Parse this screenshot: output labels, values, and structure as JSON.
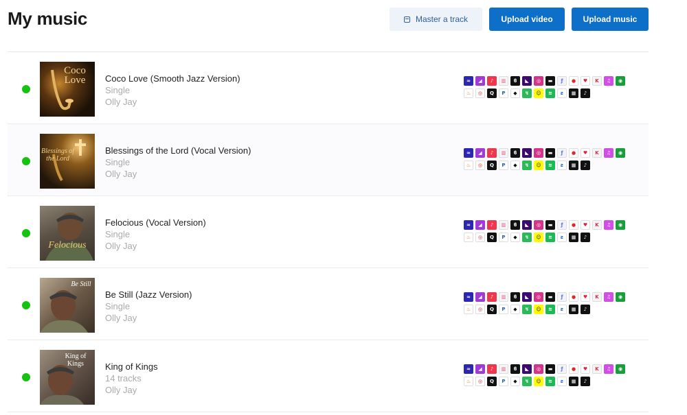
{
  "header": {
    "title": "My music",
    "master_label": "Master a track",
    "upload_video_label": "Upload video",
    "upload_music_label": "Upload music"
  },
  "colors": {
    "accent": "#0d6fc7",
    "status_live": "#15c20f",
    "muted_text": "#aaaaaa"
  },
  "releases": [
    {
      "title": "Coco Love (Smooth Jazz Version)",
      "type": "Single",
      "artist": "Olly Jay",
      "cover_text": "Coco Love"
    },
    {
      "title": "Blessings of the Lord (Vocal Version)",
      "type": "Single",
      "artist": "Olly Jay",
      "cover_text": "Blessings of the Lord"
    },
    {
      "title": "Felocious (Vocal Version)",
      "type": "Single",
      "artist": "Olly Jay",
      "cover_text": "Felocious"
    },
    {
      "title": "Be Still (Jazz Version)",
      "type": "Single",
      "artist": "Olly Jay",
      "cover_text": "Be Still"
    },
    {
      "title": "King of Kings",
      "type": "14 tracks",
      "artist": "Olly Jay",
      "cover_text": "King of Kings"
    }
  ],
  "service_icons_row1": [
    {
      "icon": "amazon-icon",
      "bg": "#2b26b3",
      "g": "≈"
    },
    {
      "icon": "deezer-icon",
      "bg": "#a23ad6",
      "g": "◢"
    },
    {
      "icon": "apple-music-icon",
      "bg": "#f0364f",
      "g": "♪"
    },
    {
      "icon": "anghami-icon",
      "bg": "#f5f5f5",
      "g": "▥",
      "fg": "#e05584"
    },
    {
      "icon": "tidal-icon",
      "bg": "#111111",
      "g": "ϐ"
    },
    {
      "icon": "audiomack-icon",
      "bg": "#3b0a6e",
      "g": "◣"
    },
    {
      "icon": "instagram-icon",
      "bg": "#d6338a",
      "g": "◎"
    },
    {
      "icon": "boomplay-icon",
      "bg": "#111111",
      "g": "▬"
    },
    {
      "icon": "flo-icon",
      "bg": "#f3f3f7",
      "g": "ƒ",
      "fg": "#5a6ee8"
    },
    {
      "icon": "youtube-icon",
      "bg": "#ffffff",
      "g": "●",
      "fg": "#e52525"
    },
    {
      "icon": "iheartradio-icon",
      "bg": "#ffffff",
      "g": "♥",
      "fg": "#e0243c"
    },
    {
      "icon": "kkbox-icon",
      "bg": "#f4f4f4",
      "g": "K",
      "fg": "#e02646"
    },
    {
      "icon": "itunes-icon",
      "bg": "#d34de8",
      "g": "♫"
    },
    {
      "icon": "napster-icon",
      "bg": "#1a9e3c",
      "g": "◉"
    }
  ],
  "service_icons_row2": [
    {
      "icon": "jiosaavn-icon",
      "bg": "#ffffff",
      "g": "♨",
      "fg": "#f06a1c"
    },
    {
      "icon": "pandora-radio-icon",
      "bg": "#ffffff",
      "g": "◎",
      "fg": "#d91f26"
    },
    {
      "icon": "qobuz-icon",
      "bg": "#111111",
      "g": "Q"
    },
    {
      "icon": "pandora-icon",
      "bg": "#ffffff",
      "g": "P",
      "fg": "#2261c6"
    },
    {
      "icon": "roblox-icon",
      "bg": "#ffffff",
      "g": "◆",
      "fg": "#111111"
    },
    {
      "icon": "resso-icon",
      "bg": "#2db85a",
      "g": "↯"
    },
    {
      "icon": "snapchat-icon",
      "bg": "#fffb00",
      "g": "☺",
      "fg": "#111111"
    },
    {
      "icon": "spotify-icon",
      "bg": "#1db954",
      "g": "≋"
    },
    {
      "icon": "shazam-icon",
      "bg": "#ffffff",
      "g": "ƨ",
      "fg": "#1a5ed6"
    },
    {
      "icon": "tencent-icon",
      "bg": "#111111",
      "g": "▦"
    },
    {
      "icon": "tiktok-icon",
      "bg": "#111111",
      "g": "♪"
    }
  ]
}
